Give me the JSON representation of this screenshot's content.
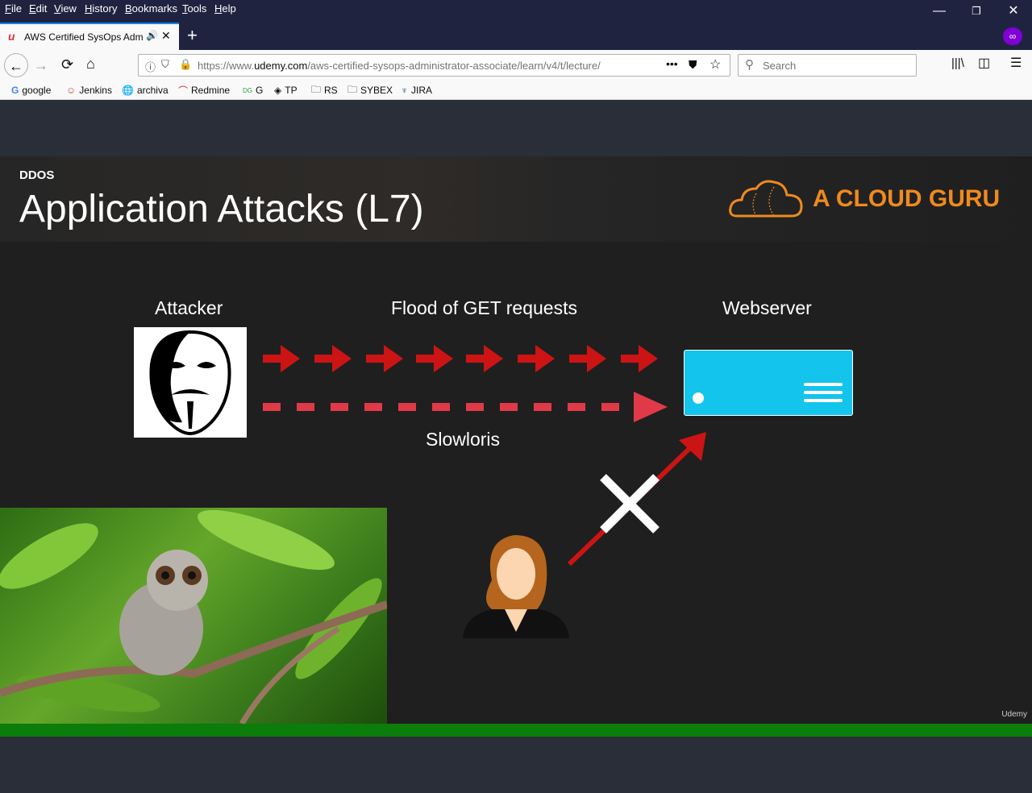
{
  "menu": [
    "File",
    "Edit",
    "View",
    "History",
    "Bookmarks",
    "Tools",
    "Help"
  ],
  "window_controls": {
    "minimize": "—",
    "restore": "❐",
    "close": "✕"
  },
  "tab": {
    "title": "AWS Certified SysOps Admi",
    "new_tab": "+"
  },
  "url": {
    "prefix": "https://www.",
    "domain": "udemy.com",
    "path": "/aws-certified-sysops-administrator-associate/learn/v4/t/lecture/"
  },
  "search": {
    "placeholder": "Search"
  },
  "bookmarks": [
    "google",
    "Jenkins",
    "archiva",
    "Redmine",
    "G",
    "TP",
    "RS",
    "SYBEX",
    "JIRA"
  ],
  "slide": {
    "small_title": "DDOS",
    "title": "Application Attacks (L7)",
    "brand": "A CLOUD GURU",
    "attacker_label": "Attacker",
    "flood_label": "Flood of GET requests",
    "webserver_label": "Webserver",
    "slowloris_label": "Slowloris",
    "watermark": "Udemy"
  },
  "progress": 1.0,
  "colors": {
    "accent_red": "#cc1414",
    "slowloris_red": "#e03a48",
    "server_blue": "#13c4ec",
    "brand_orange": "#ef8a1e",
    "progress_green": "#0a7d0a"
  }
}
